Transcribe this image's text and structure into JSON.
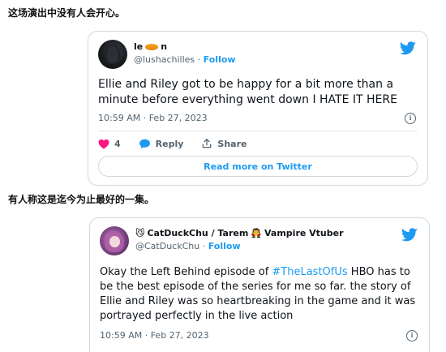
{
  "captions": {
    "first": "这场演出中没有人会开心。",
    "second": "有人称这是迄今为止最好的一集。"
  },
  "tweet1": {
    "name": "le",
    "name_suffix": "n",
    "handle": "@lushachilles",
    "separator": "·",
    "follow": "Follow",
    "text": "Ellie and Riley got to be happy for a bit more than a minute before everything went down I HATE IT HERE",
    "timestamp": "10:59 AM · Feb 27, 2023",
    "likes": "4",
    "reply": "Reply",
    "share": "Share",
    "read_more": "Read more on Twitter"
  },
  "tweet2": {
    "name_prefix_emoji": "😼",
    "name_part1": "CatDuckChu / Tarem",
    "name_emoji": "🧛",
    "name_part2": "Vampire Vtuber",
    "handle": "@CatDuckChu",
    "separator": "·",
    "follow": "Follow",
    "text_before": "Okay the Left Behind episode of ",
    "hashtag": "#TheLastOfUs",
    "text_after": " HBO has to be the best episode of the series for me so far. the story of Ellie and Riley was so heartbreaking in the game and it was portrayed perfectly in the live action",
    "timestamp": "10:59 AM · Feb 27, 2023"
  },
  "colors": {
    "twitter_blue": "#1d9bf0",
    "like_pink": "#f91880",
    "muted_text": "#536471",
    "border": "#cfd9de"
  },
  "icons": {
    "twitter": "twitter-bird-icon",
    "like": "heart-icon",
    "reply": "speech-bubble-icon",
    "share": "share-upload-icon",
    "info": "info-icon"
  }
}
